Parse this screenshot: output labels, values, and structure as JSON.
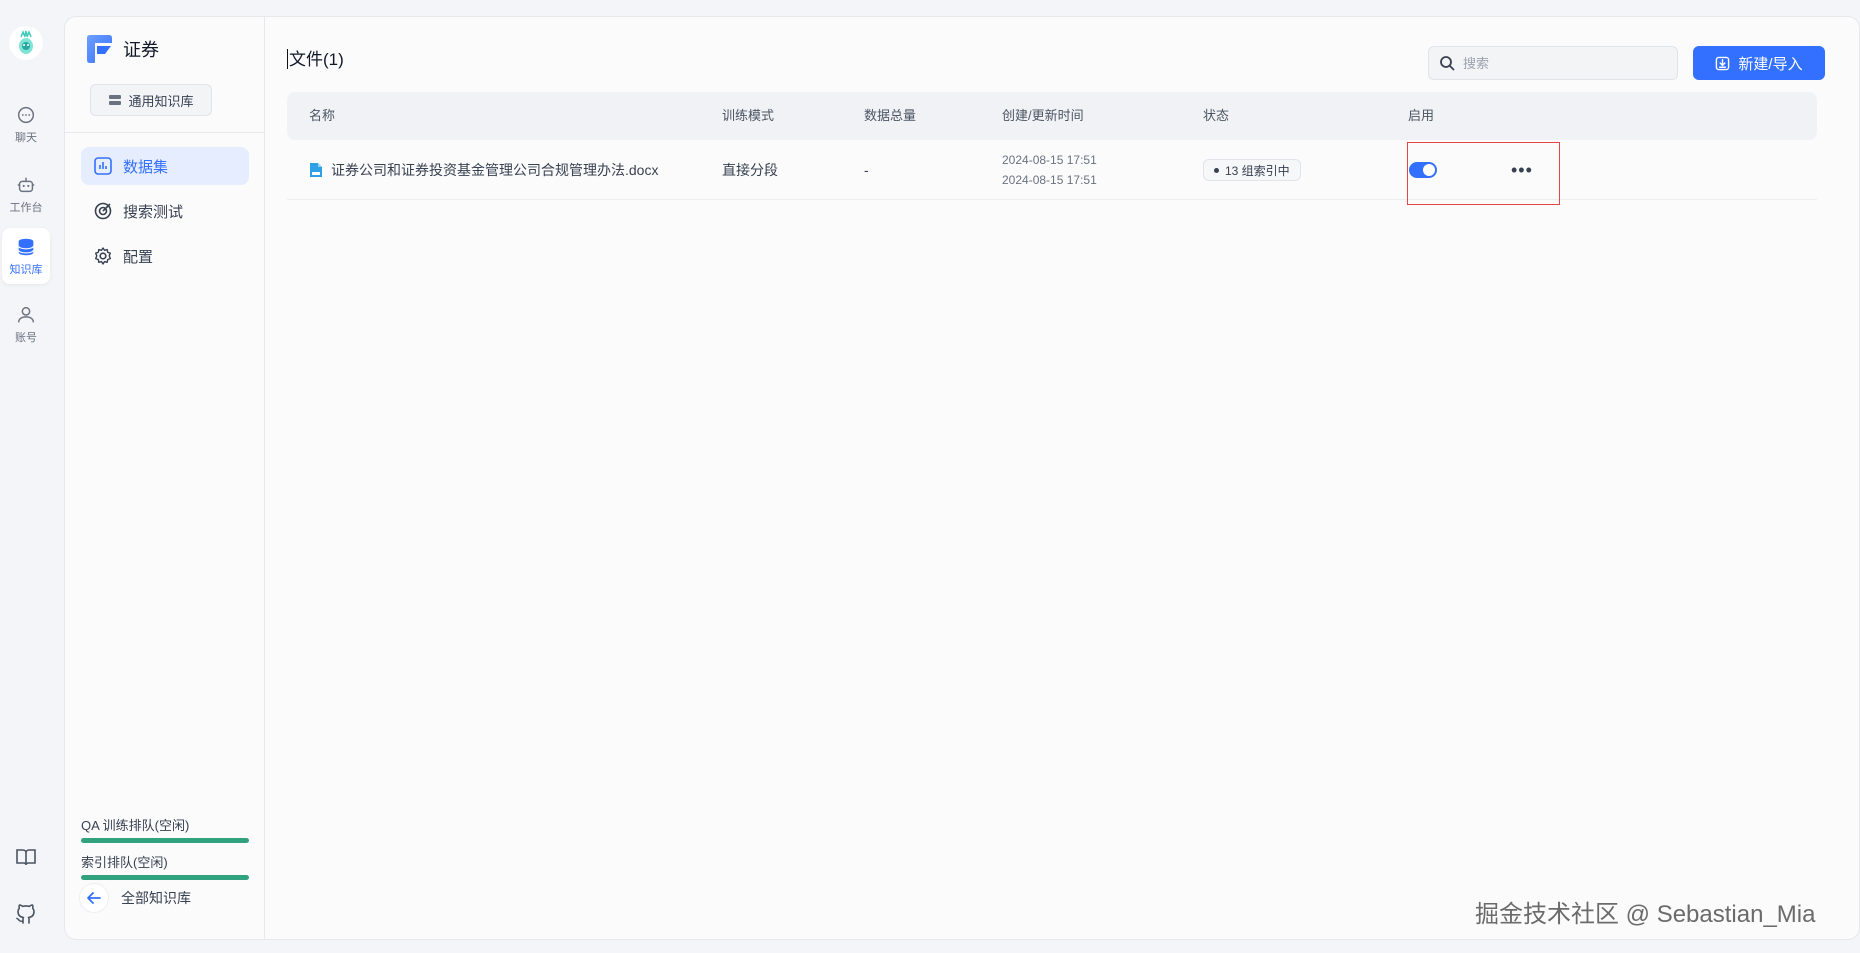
{
  "rail": {
    "items": [
      {
        "label": "聊天",
        "icon": "chat-icon"
      },
      {
        "label": "工作台",
        "icon": "robot-icon"
      },
      {
        "label": "知识库",
        "icon": "database-icon",
        "active": true
      },
      {
        "label": "账号",
        "icon": "user-icon"
      }
    ],
    "bottom_icons": [
      "book-icon",
      "github-icon"
    ]
  },
  "kb": {
    "title": "证券",
    "type_badge": "通用知识库",
    "nav": [
      {
        "label": "数据集",
        "icon": "chart-icon",
        "active": true
      },
      {
        "label": "搜索测试",
        "icon": "target-icon"
      },
      {
        "label": "配置",
        "icon": "gear-icon"
      }
    ],
    "queues": [
      {
        "label": "QA 训练排队(空闲)"
      },
      {
        "label": "索引排队(空闲)"
      }
    ],
    "back_label": "全部知识库"
  },
  "main": {
    "title": "文件(1)",
    "search_placeholder": "搜索",
    "new_button": "新建/导入",
    "columns": [
      "名称",
      "训练模式",
      "数据总量",
      "创建/更新时间",
      "状态",
      "启用"
    ],
    "rows": [
      {
        "name": "证券公司和证券投资基金管理公司合规管理办法.docx",
        "mode": "直接分段",
        "total": "-",
        "created": "2024-08-15 17:51",
        "updated": "2024-08-15 17:51",
        "status": "13 组索引中",
        "enabled": true
      }
    ]
  },
  "watermark": "掘金技术社区 @ Sebastian_Mia",
  "colors": {
    "accent": "#3370ff",
    "queue_bar": "#32a27e",
    "highlight": "#e64545"
  }
}
